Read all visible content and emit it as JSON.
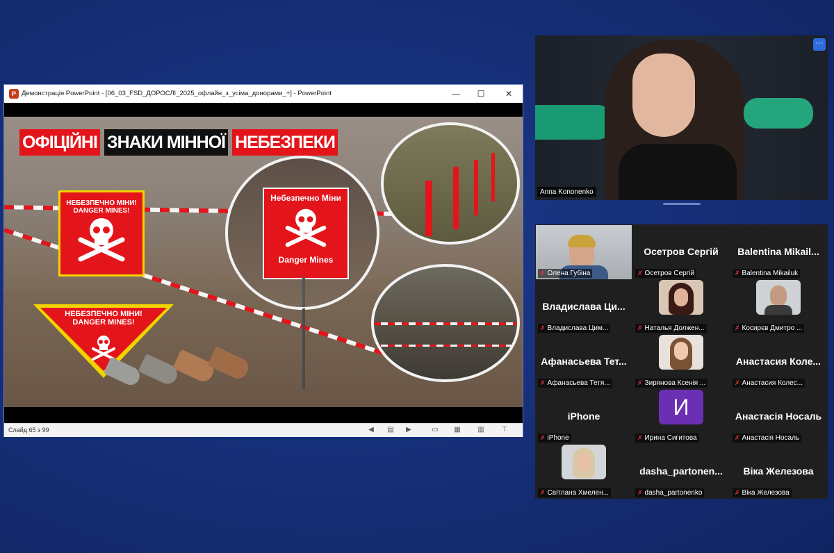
{
  "powerpoint": {
    "title": "Демонстрація PowerPoint - [06_03_FSD_ДОРОСЛІ_2025_офлайн_з_усіма_донорами_+] - PowerPoint",
    "app_icon": "P",
    "slide_counter": "Слайд 65 з 99",
    "window_controls": {
      "minimize": "—",
      "maximize": "☐",
      "close": "✕"
    }
  },
  "slide": {
    "title_part1": "ОФІЦІЙНІ",
    "title_part2": "ЗНАКИ МІННОЇ",
    "title_part3": "НЕБЕЗПЕКИ",
    "square_sign": "НЕБЕЗПЕЧНО МІНИ! DANGER MINES!",
    "triangle_sign_line1": "НЕБЕЗПЕЧНО МІНИ!",
    "triangle_sign_line2": "DANGER MINES!",
    "circle_sign_top": "Небезпечно Міни",
    "circle_sign_bottom": "Danger Mines"
  },
  "speaker": {
    "name": "Anna Kononenko",
    "more_label": "···"
  },
  "participants": [
    {
      "display": "",
      "label": "Олена Губіна",
      "type": "video"
    },
    {
      "display": "Осетров Сергій",
      "label": "Осетров Сергій",
      "type": "name"
    },
    {
      "display": "Balentina Mikail...",
      "label": "Balentina Mikailuk",
      "type": "name"
    },
    {
      "display": "Владислава Ци...",
      "label": "Владислава Цим...",
      "type": "name"
    },
    {
      "display": "",
      "label": "Наталья Должен...",
      "type": "photo"
    },
    {
      "display": "",
      "label": "Косирєв Дмитро ...",
      "type": "photo"
    },
    {
      "display": "Афанасьева Тет...",
      "label": "Афанасьева Тетя...",
      "type": "name"
    },
    {
      "display": "",
      "label": "Зирянова Ксенія ...",
      "type": "photo"
    },
    {
      "display": "Анастасия Коле...",
      "label": "Анастасия Колес...",
      "type": "name"
    },
    {
      "display": "iPhone",
      "label": "iPhone",
      "type": "name"
    },
    {
      "display": "И",
      "label": "Ирина Сигитова",
      "type": "initial"
    },
    {
      "display": "Анастасія Носаль",
      "label": "Анастасія Носаль",
      "type": "name"
    },
    {
      "display": "",
      "label": "Світлана Хмелен...",
      "type": "photo"
    },
    {
      "display": "dasha_partonen...",
      "label": "dasha_partonenko",
      "type": "name"
    },
    {
      "display": "Віка Железова",
      "label": "Віка Железова",
      "type": "name"
    }
  ],
  "colors": {
    "accent_red": "#e3151b",
    "sign_yellow": "#f3d400",
    "zoom_blue": "#2d6cdf"
  }
}
